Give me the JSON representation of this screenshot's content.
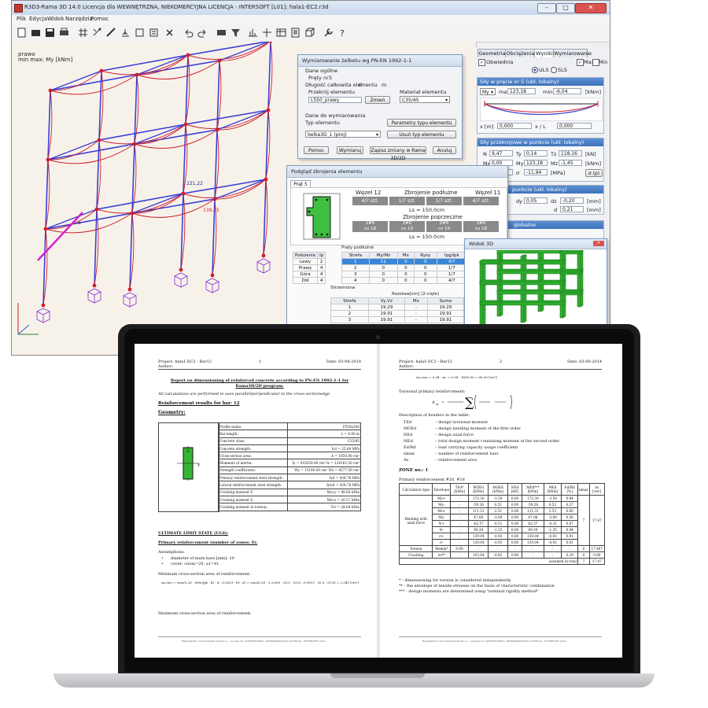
{
  "app": {
    "title": "R3D3-Rama 3D 14.0 Licencja dla WEWNĘTRZNA, NIEKOMERCYJNA LICENCJA - INTERSOFT [L01]: hala1-EC2.r3d",
    "menu": [
      "Plik",
      "Edycja",
      "Widok",
      "Narzędzia",
      "Pomoc"
    ],
    "viewport": {
      "label1": "prawo",
      "label2": "min max: My [kNm]",
      "val1": "221,22",
      "val2": "139,75",
      "val3": "6"
    },
    "right_tabs": [
      "Geometria",
      "Obciążenia",
      "Wyniki",
      "Wymiarowanie"
    ],
    "obwiednia": "Obwiednia",
    "max": "Max",
    "min": "Min",
    "uls": "ULS",
    "sls": "SLS",
    "forces": {
      "header": "Siły w pręcie nr 5 (ukł. lokalny)",
      "component": "My",
      "max_label": "max",
      "max_value": "123,18",
      "min_label": "min",
      "min_value": "-6,04",
      "unit": "[kNm]",
      "x_label": "x [m]",
      "x_value": "0,000",
      "xl_label": "x / L",
      "xl_value": "0,000"
    },
    "section": {
      "header": "Siły przekrojowe w punkcie (ukł. lokalny)",
      "N_label": "N",
      "N": "9,47",
      "Ty_label": "Ty",
      "Ty": "0,14",
      "Tz_label": "Tz",
      "Tz": "118,16",
      "unit1": "[kN]",
      "Mx_label": "Mx",
      "Mx": "0,00",
      "My_label": "My",
      "My": "123,18",
      "Mz_label": "Mz",
      "Mz": "-1,45",
      "unit2": "[kNm]",
      "sigma_label": "σ",
      "sigma": "-4,90",
      "sigma2_label": "σ",
      "sigma2": "-11,94",
      "unit3": "[MPa]",
      "sigp": "σ (p)"
    },
    "displ": {
      "header": "punkcie (ukł. lokalny)",
      "dy_label": "dy",
      "dy": "0,05",
      "dz_label": "dz",
      "dz": "-0,20",
      "d_label": "d",
      "d": "0,21",
      "unit": "[mm]"
    },
    "global": {
      "header": "globalne"
    }
  },
  "dlg_wym": {
    "title": "Wymiarowanie żelbetu wg PN-EN 1992-1-1",
    "general": "Dane ogólne",
    "bar_label": "Pręty nr",
    "bar_value": "5",
    "length_label": "Długość całkowita elementu",
    "length_value": "6",
    "length_unit": "m",
    "section_label": "Przekrój elementu",
    "section_value": "L550_prawy",
    "change": "Zmień",
    "material_label": "Materiał elementu",
    "material_value": "C35/45",
    "dim_data": "Dane do wymiarowania",
    "type_label": "Typ elementu",
    "type_value": "belka3D_1 (proj)",
    "params": "Parametry typu elementu",
    "delete_type": "Usuń typ elementu",
    "help": "Pomoc",
    "dimension": "Wymiaruj",
    "save": "Zapisz zmiany w Rama 3D/2D",
    "cancel": "Anuluj"
  },
  "dlg_preview": {
    "title": "Podgląd zbrojenia elementu",
    "tab": "Pręt 5",
    "node_left": "Węzeł 12",
    "long_title": "Zbrojenie podłużne",
    "node_right": "Węzeł 11",
    "bars": [
      "4/7 szt.",
      "1/7 szt.",
      "1/7 szt.",
      "4/7 szt."
    ],
    "ls1": "Ls = 150.0cm",
    "trans_title": "Zbrojenie poprzeczne",
    "stirrups": [
      "2#6\nco 18",
      "2#6\nco 19",
      "2#6\nco 19",
      "2#6\nco 18"
    ],
    "ls2": "Ls = 150.0cm",
    "pos_head": [
      "Położenie",
      "Ip"
    ],
    "pos_rows": [
      [
        "Lewy",
        "2"
      ],
      [
        "Prawy",
        "4"
      ],
      [
        "Góra",
        "4"
      ],
      [
        "Dół",
        "4"
      ]
    ],
    "long_head": "Pręty podłużne",
    "zone_head": [
      "Strefa",
      "My/Mz",
      "Mx",
      "Rysy",
      "Ipg/Ipk"
    ],
    "zone_rows": [
      [
        "1",
        "11",
        "0",
        "0",
        "4/7"
      ],
      [
        "2",
        "0",
        "0",
        "0",
        "1/7"
      ],
      [
        "3",
        "0",
        "0",
        "0",
        "1/7"
      ],
      [
        "4",
        "0",
        "0",
        "0",
        "4/7"
      ]
    ],
    "stir_head": "Strzemiona",
    "rozstaw": "Rozstaw[cm] (2-cięte)",
    "stir_cols": [
      "Strefa",
      "Vy,Vz",
      "Mx",
      "Suma"
    ],
    "stir_rows": [
      [
        "1",
        "19.29",
        "-",
        "19.29"
      ],
      [
        "2",
        "19.91",
        "-",
        "19.91"
      ],
      [
        "3",
        "19.91",
        "-",
        "19.91"
      ]
    ]
  },
  "dlg_3d": {
    "title": "Widok 3D"
  },
  "doc": {
    "p1": {
      "project": "Project: hala1-EC2 - Bar12",
      "author": "Author:",
      "page": "1",
      "date": "Date: 03-06-2014",
      "report_title": "Report on dimensioning of reinforced concrete according to PN-EN 1992-1-1 for Rama3D/2D program:",
      "note": "All calculations are performed in axes parallel/perpendicular to the cross-sectionedge.",
      "results": "Reinforcement results for bar: 12",
      "geometry": "Geometry:",
      "geo_rows": [
        [
          "Profile name:",
          "P550x300"
        ],
        [
          "Bar length:",
          "L = 6.00 m"
        ],
        [
          "Concrete class:",
          "C35/45"
        ],
        [
          "Concrete strength:",
          "fcd = 25.00 MPa"
        ],
        [
          "Cross-section area:",
          "A = 1650.00 cm²"
        ],
        [
          "Moments of inertia:",
          "Iy = 418350.00 cm⁴   Iz = 124162.50 cm⁴"
        ],
        [
          "Strength coefficients:",
          "Wy = 15140.00 cm³   Wz = 8277.50 cm³"
        ],
        [
          "Primary reinforcement steel strength:",
          "fyd = 434.78 MPa"
        ],
        [
          "Lateral reinforcement steel strength:",
          "fywd = 434.78 MPa"
        ],
        [
          "Cracking moment Y:",
          "Mcr,y = 48.60 kNm"
        ],
        [
          "Cracking moment Z:",
          "Mcr,z = 26.57 kNm"
        ],
        [
          "Cracking moment in torsion:",
          "Tcr = 28.64 kNm"
        ]
      ],
      "uls": "ULTIMATE LIMIT STATE (ULS):",
      "primary": "Primary reinforcement (number of zones: 4):",
      "assumptions": "Assumptions:",
      "a1": "diameter of main bars [mm]: 20",
      "a2": "cover: cnom=20, a1=41",
      "min_area": "Minimum cross-section area of reinforcement:",
      "formula": "As,min = max(0.26 · fctm/fyk · bt · d ; 0.0013 · bt · d) = max(0.26 · 3.2/500 · 30.0 · 53.8 ; 0.0013 · 30.0 · 53.8) = 2.340 [cm²]",
      "max_area": "Maximum cross-section area of reinforcement:",
      "footer": "Rama3D/2D v.14.0 RomaCD Studio s.c., License for: WEWNĘTRZNA, NIEKOMERCYJNA LICENCJA - INTERSOFT [L01]"
    },
    "p2": {
      "project": "Project: hala1-EC2 - Bar12",
      "author": "Author:",
      "page": "2",
      "date": "Date: 03-06-2014",
      "formula1": "As,max = 0.04 · Ac = 0.04 · 1650.00 = 66.00 [cm²]",
      "torsion": "Torsional primary reinforcement:",
      "desc": "Description of headers in the table:",
      "defs": [
        [
          "TEd",
          "– design torsional moment"
        ],
        [
          "MOEd",
          "– design bending moment of the first order"
        ],
        [
          "NEd",
          "– design axial force"
        ],
        [
          "MEd",
          "– total design moment containing moment of the second order"
        ],
        [
          "Ed/Rd",
          "– load carrying capacity usage coefficient"
        ],
        [
          "nmax",
          "– number of reinforcement bars"
        ],
        [
          "As",
          "– reinforcement area"
        ]
      ],
      "zone": "ZONE no.: 1",
      "prim": "Primary reinforcement #20, #18",
      "cols": [
        "Calculation type",
        "Envelope",
        "TEd* [kNm]",
        "MOEd [kNm]",
        "MOEd [kNm]",
        "NEd [kN]",
        "MEd*** [kNm]",
        "MEd [kNm]",
        "Ed/Rd [%]",
        "nmax",
        "As [cm²]"
      ],
      "rows": [
        [
          "My+",
          "-",
          "173.30",
          "-3.59",
          "0.00",
          "173.30",
          "-3.59",
          "0.84"
        ],
        [
          "My-",
          "-",
          "-59.26",
          "0.52",
          "0.00",
          "-59.26",
          "0.52",
          "0.27"
        ],
        [
          "Mz+",
          "-",
          "111.31",
          "2.53",
          "0.00",
          "111.31",
          "2.53",
          "0.80"
        ],
        [
          "Mz-",
          "-",
          "47.88",
          "-3.89",
          "0.00",
          "47.88",
          "-3.89",
          "0.56"
        ],
        [
          "N+",
          "-",
          "-62.57",
          "-0.31",
          "0.00",
          "62.57",
          "-0.31",
          "0.87"
        ],
        [
          "N-",
          "-",
          "99.39",
          "-1.35",
          "0.00",
          "99.39",
          "-1.35",
          "0.94"
        ],
        [
          "σ+",
          "-",
          "139.04",
          "-0.93",
          "0.00",
          "139.04",
          "-0.93",
          "0.91"
        ],
        [
          "σ-",
          "-",
          "139.04",
          "-0.93",
          "0.00",
          "139.04",
          "-0.93",
          "0.91"
        ]
      ],
      "bending": "Bending with axial force",
      "nmax_val": "7",
      "as_val": "17.47",
      "torsion_row": [
        "Torsion",
        "Msmin*",
        "0.00",
        "-",
        "-",
        "-",
        "-",
        "-",
        "-",
        "0",
        "17.467"
      ],
      "cracking_row": [
        "Cracking",
        "σs**",
        "-",
        "103.64",
        "-0.82",
        "0.00",
        "-",
        "-",
        "0.29",
        "0",
        "0.00"
      ],
      "assumed": "assumed in total",
      "assumed_n": "7",
      "assumed_as": "17.47",
      "n1": "* - dimensioning for torsion is considered independently",
      "n2": "** - the envelope of tensile stresses on the basis of characteristic combination",
      "n3": "*** - design moments are determined using \"nominal rigidity method\"",
      "footer": "Rama3D/2D v.14.0 RomaCD Studio s.c., License for: WEWNĘTRZNA, NIEKOMERCYJNA LICENCJA - INTERSOFT [L01]"
    }
  },
  "colors": {
    "frame": "#3b3fd6",
    "envelope": "#d01e2e",
    "support": "#8a2bd8",
    "highlight": "#d21fd2",
    "view3d": "#2fae2f",
    "accent": "#3d73bd"
  }
}
